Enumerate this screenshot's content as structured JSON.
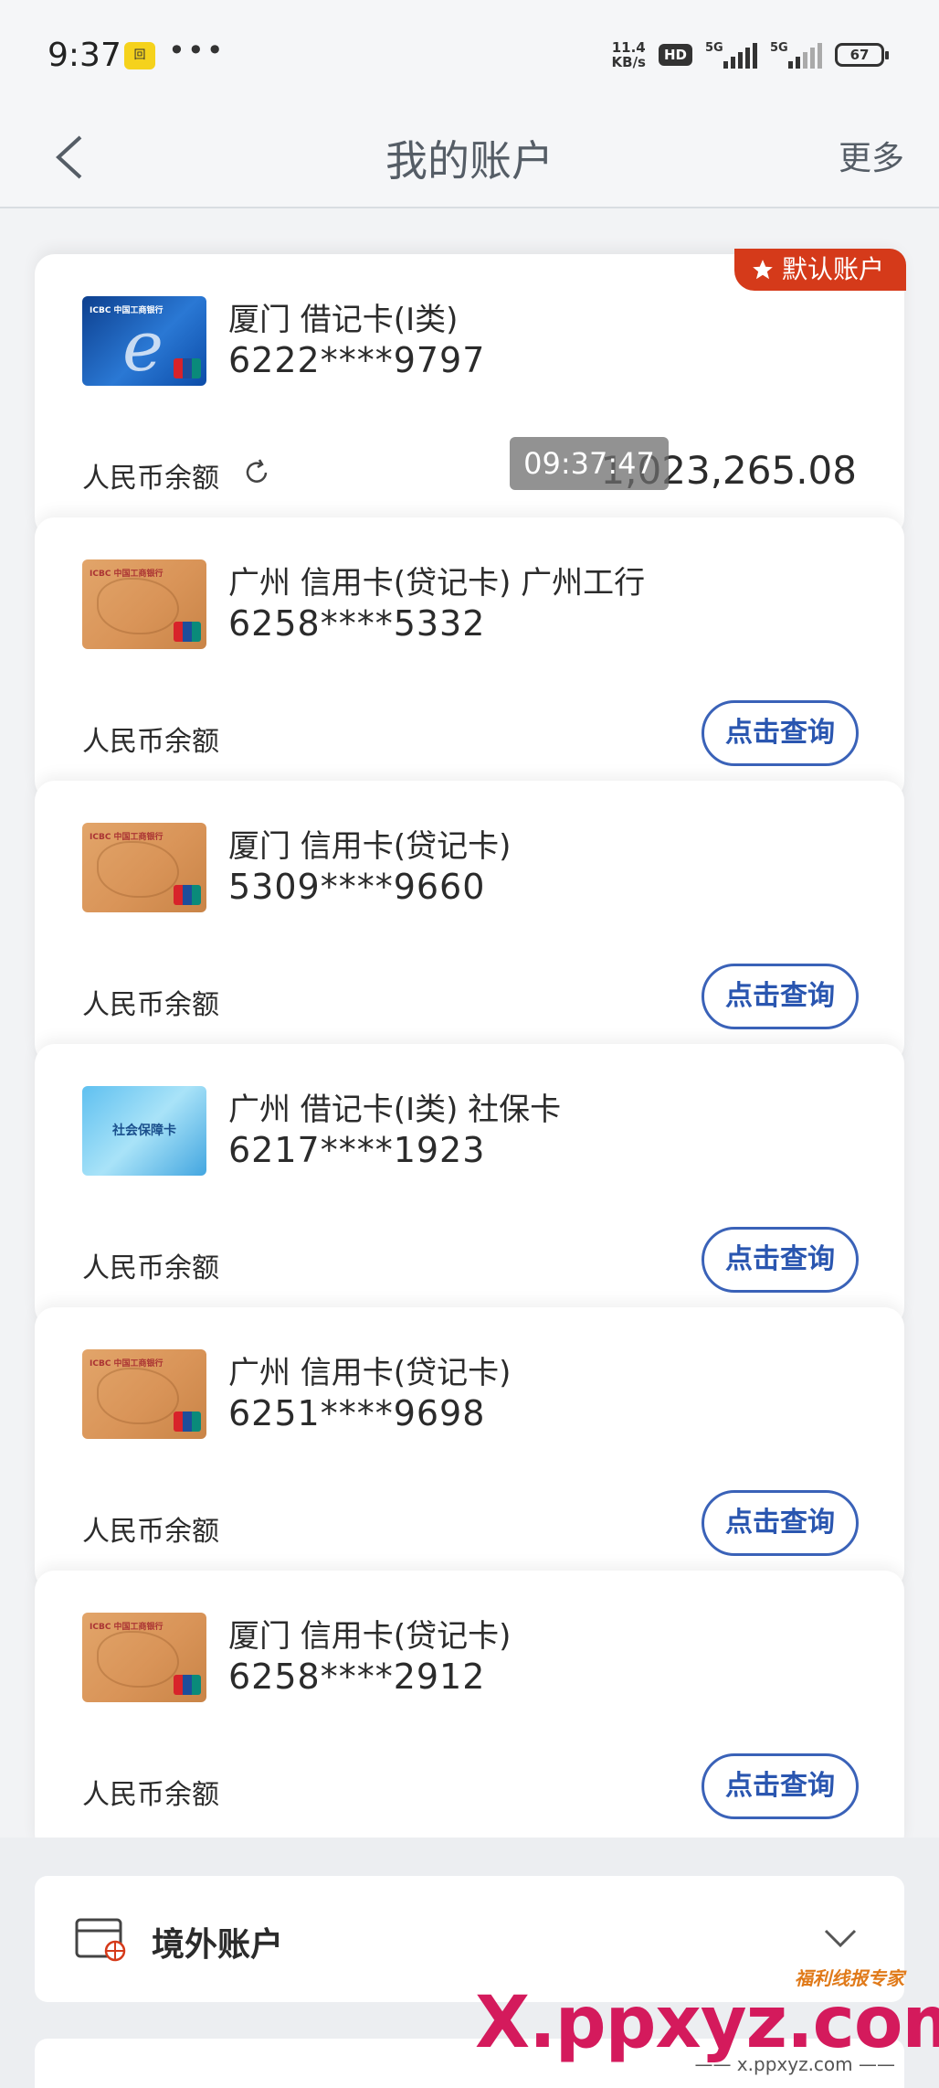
{
  "status_bar": {
    "time": "9:37",
    "app_badge": "回",
    "dots": "•••",
    "net_speed_value": "11.4",
    "net_speed_unit": "KB/s",
    "hd": "HD",
    "sig1_label": "5G",
    "sig2_label": "5G",
    "battery": "67"
  },
  "header": {
    "title": "我的账户",
    "more": "更多"
  },
  "accounts": [
    {
      "card_style": "blue",
      "name": "厦门 借记卡(I类)",
      "number": "6222****9797",
      "balance_label": "人民币余额",
      "balance": "1,023,265.08",
      "timestamp": "09:37:47",
      "default_tag": "默认账户"
    },
    {
      "card_style": "gold",
      "name": "广州 信用卡(贷记卡) 广州工行",
      "number": "6258****5332",
      "balance_label": "人民币余额",
      "query_label": "点击查询"
    },
    {
      "card_style": "gold",
      "name": "厦门 信用卡(贷记卡)",
      "number": "5309****9660",
      "balance_label": "人民币余额",
      "query_label": "点击查询"
    },
    {
      "card_style": "social",
      "card_text": "社会保障卡",
      "name": "广州 借记卡(I类)  社保卡",
      "number": "6217****1923",
      "balance_label": "人民币余额",
      "query_label": "点击查询"
    },
    {
      "card_style": "gold",
      "name": "广州 信用卡(贷记卡)",
      "number": "6251****9698",
      "balance_label": "人民币余额",
      "query_label": "点击查询"
    },
    {
      "card_style": "gold",
      "name": "厦门 信用卡(贷记卡)",
      "number": "6258****2912",
      "balance_label": "人民币余额",
      "query_label": "点击查询"
    }
  ],
  "card_logo_text": "ICBC 中国工商银行",
  "overseas": {
    "label": "境外账户"
  },
  "watermark": {
    "brand": "福利线报专家",
    "main": "X.ppxyz.com",
    "sub": "—— x.ppxyz.com ——"
  },
  "colors": {
    "accent": "#3a62b8",
    "default_tag": "#d53a1a",
    "background": "#f2f3f5"
  }
}
